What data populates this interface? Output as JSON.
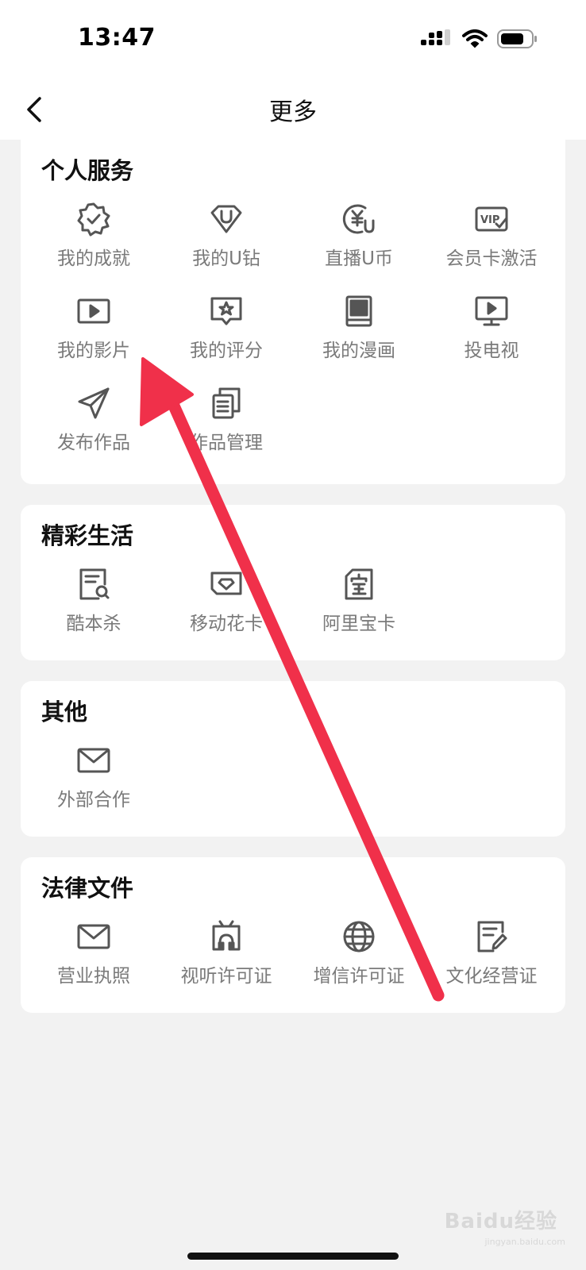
{
  "status_bar": {
    "time": "13:47"
  },
  "nav": {
    "title": "更多"
  },
  "sections": [
    {
      "title": "个人服务",
      "items": [
        {
          "label": "我的成就",
          "icon": "badge-check-icon"
        },
        {
          "label": "我的U钻",
          "icon": "u-diamond-icon"
        },
        {
          "label": "直播U币",
          "icon": "u-coin-icon"
        },
        {
          "label": "会员卡激活",
          "icon": "vip-card-icon"
        },
        {
          "label": "我的影片",
          "icon": "video-play-icon"
        },
        {
          "label": "我的评分",
          "icon": "star-rating-icon"
        },
        {
          "label": "我的漫画",
          "icon": "comic-book-icon"
        },
        {
          "label": "投电视",
          "icon": "tv-cast-icon"
        },
        {
          "label": "发布作品",
          "icon": "send-plane-icon"
        },
        {
          "label": "作品管理",
          "icon": "documents-icon"
        }
      ]
    },
    {
      "title": "精彩生活",
      "items": [
        {
          "label": "酷本杀",
          "icon": "script-search-icon"
        },
        {
          "label": "移动花卡",
          "icon": "flower-card-icon"
        },
        {
          "label": "阿里宝卡",
          "icon": "treasure-card-icon"
        }
      ]
    },
    {
      "title": "其他",
      "items": [
        {
          "label": "外部合作",
          "icon": "mail-icon"
        }
      ]
    },
    {
      "title": "法律文件",
      "items": [
        {
          "label": "营业执照",
          "icon": "mail-icon"
        },
        {
          "label": "视听许可证",
          "icon": "tv-headphones-icon"
        },
        {
          "label": "增信许可证",
          "icon": "globe-icon"
        },
        {
          "label": "文化经营证",
          "icon": "document-edit-icon"
        }
      ]
    }
  ],
  "watermark": {
    "text": "Baidu经验",
    "sub": "jingyan.baidu.com"
  },
  "colors": {
    "background": "#f2f2f2",
    "card": "#ffffff",
    "label": "#7a7a7a",
    "icon": "#555555",
    "arrow": "#f0304a"
  }
}
